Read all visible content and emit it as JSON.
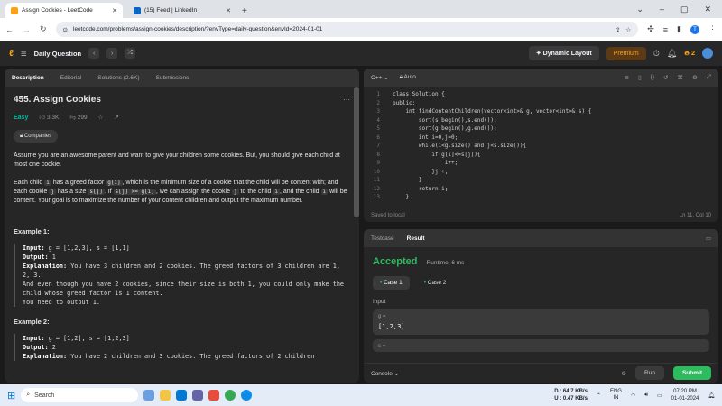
{
  "browser": {
    "tabs": [
      {
        "title": "Assign Cookies - LeetCode",
        "active": true
      },
      {
        "title": "(15) Feed | LinkedIn",
        "active": false
      }
    ],
    "url": "leetcode.com/problems/assign-cookies/description/?envType=daily-question&envId=2024-01-01",
    "profile_initial": "T"
  },
  "nav": {
    "section": "Daily Question",
    "dynamic_layout": "Dynamic Layout",
    "premium": "Premium",
    "streak": "2"
  },
  "left_tabs": [
    "Description",
    "Editorial",
    "Solutions (2.6K)",
    "Submissions"
  ],
  "problem": {
    "title": "455. Assign Cookies",
    "difficulty": "Easy",
    "likes": "3.3K",
    "dislikes": "299",
    "companies": "Companies",
    "p1": "Assume you are an awesome parent and want to give your children some cookies. But, you should give each child at most one cookie.",
    "p2a": "Each child ",
    "p2b": " has a greed factor ",
    "p2c": ", which is the minimum size of a cookie that the child will be content with; and each cookie ",
    "p2d": " has a size ",
    "p2e": ". If ",
    "p2f": ", we can assign the cookie ",
    "p2g": " to the child ",
    "p2h": ", and the child ",
    "p2i": " will be content. Your goal is to maximize the number of your content children and output the maximum number.",
    "code_i": "i",
    "code_gi": "g[i]",
    "code_j": "j",
    "code_sj": "s[j]",
    "code_cond": "s[j] >= g[i]",
    "example1_title": "Example 1:",
    "example1": {
      "input_label": "Input:",
      "input": "g = [1,2,3], s = [1,1]",
      "output_label": "Output:",
      "output": "1",
      "expl_label": "Explanation:",
      "expl1": "You have 3 children and 2 cookies. The greed factors of 3 children are 1, 2, 3.",
      "expl2": "And even though you have 2 cookies, since their size is both 1, you could only make the child whose greed factor is 1 content.",
      "expl3": "You need to output 1."
    },
    "example2_title": "Example 2:",
    "example2": {
      "input_label": "Input:",
      "input": "g = [1,2], s = [1,2,3]",
      "output_label": "Output:",
      "output": "2",
      "expl_label": "Explanation:",
      "expl1": "You have 2 children and 3 cookies. The greed factors of 2 children"
    }
  },
  "editor": {
    "language": "C++",
    "mode": "Auto",
    "line_numbers": [
      "1",
      "2",
      "3",
      "4",
      "5",
      "6",
      "7",
      "8",
      "9",
      "10",
      "11",
      "12",
      "13"
    ],
    "code": "class Solution {\npublic:\n    int findContentChildren(vector<int>& g, vector<int>& s) {\n        sort(s.begin(),s.end());\n        sort(g.begin(),g.end());\n        int i=0,j=0;\n        while(i<g.size() and j<s.size()){\n            if(g[i]<=s[j]){\n                i++;\n            }j++;\n        }\n        return i;\n    }",
    "saved": "Saved to local",
    "cursor": "Ln 11, Col 10"
  },
  "result": {
    "tabs": [
      "Testcase",
      "Result"
    ],
    "status": "Accepted",
    "runtime": "Runtime: 6 ms",
    "cases": [
      "Case 1",
      "Case 2"
    ],
    "input_label": "Input",
    "var1_name": "g =",
    "var1_value": "[1,2,3]",
    "var2_name": "s =",
    "console": "Console",
    "run": "Run",
    "submit": "Submit"
  },
  "taskbar": {
    "search": "Search",
    "download": "D : 64.7 KB/s",
    "upload": "U : 0.47 KB/s",
    "lang": "ENG",
    "lang2": "IN",
    "time": "07:20 PM",
    "date": "01-01-2024"
  }
}
